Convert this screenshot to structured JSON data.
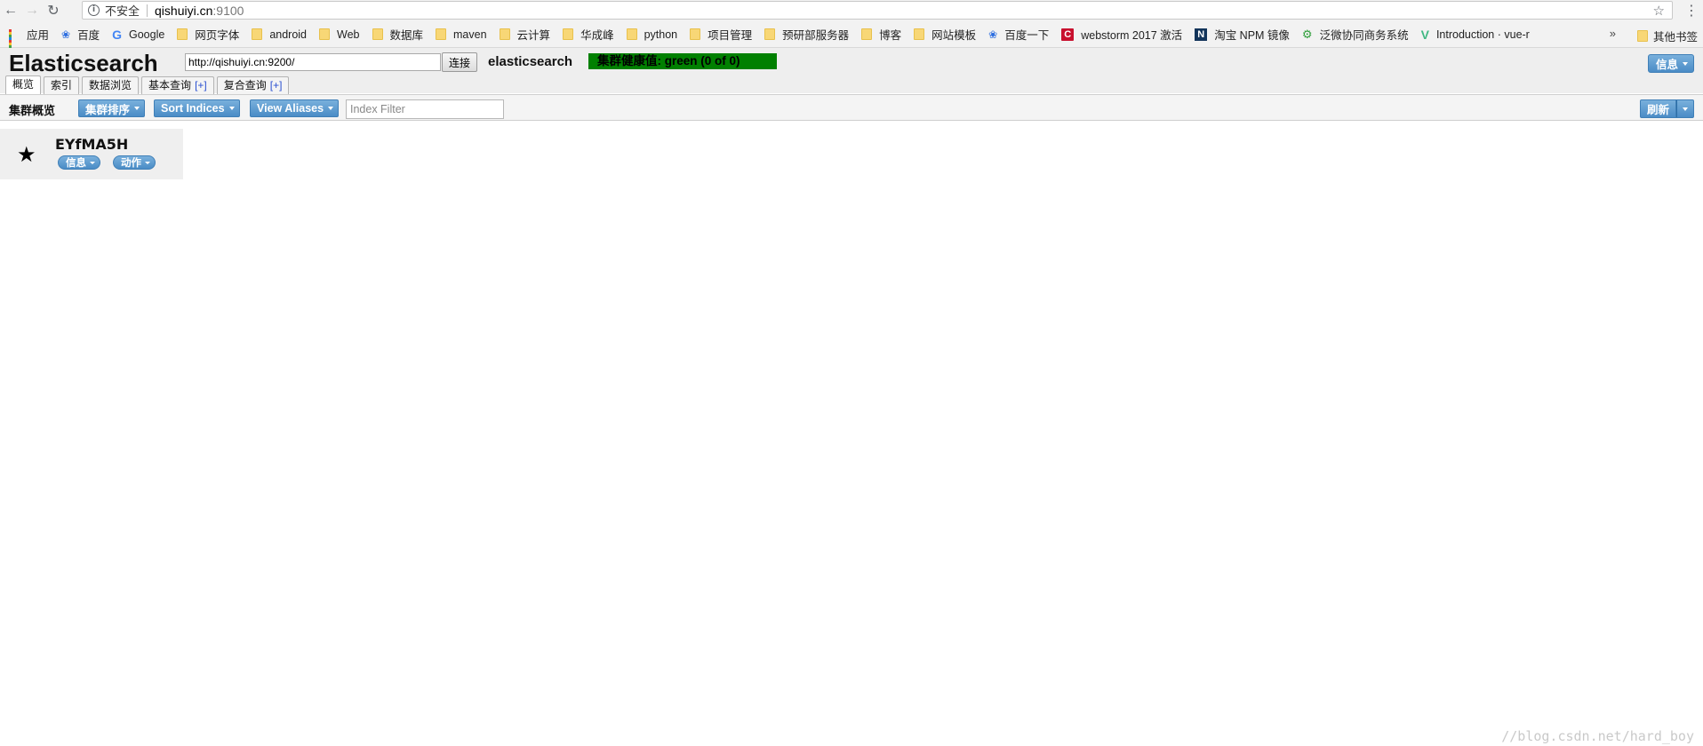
{
  "browser": {
    "security_label": "不安全",
    "url_host": "qishuiyi.cn",
    "url_port": ":9100",
    "bookmarks": [
      {
        "label": "应用",
        "icon": "apps-icon"
      },
      {
        "label": "百度",
        "icon": "paw-icon"
      },
      {
        "label": "Google",
        "icon": "google-icon"
      },
      {
        "label": "网页字体",
        "icon": "folder-icon"
      },
      {
        "label": "android",
        "icon": "folder-icon"
      },
      {
        "label": "Web",
        "icon": "folder-icon"
      },
      {
        "label": "数据库",
        "icon": "folder-icon"
      },
      {
        "label": "maven",
        "icon": "folder-icon"
      },
      {
        "label": "云计算",
        "icon": "folder-icon"
      },
      {
        "label": "华成峰",
        "icon": "folder-icon"
      },
      {
        "label": "python",
        "icon": "folder-icon"
      },
      {
        "label": "项目管理",
        "icon": "folder-icon"
      },
      {
        "label": "预研部服务器",
        "icon": "folder-icon"
      },
      {
        "label": "博客",
        "icon": "folder-icon"
      },
      {
        "label": "网站模板",
        "icon": "folder-icon"
      },
      {
        "label": "百度一下",
        "icon": "paw-icon"
      },
      {
        "label": "webstorm 2017 激活",
        "icon": "c-icon"
      },
      {
        "label": "淘宝 NPM 镜像",
        "icon": "n-icon"
      },
      {
        "label": "泛微协同商务系统",
        "icon": "gear-icon"
      },
      {
        "label": "Introduction · vue-r",
        "icon": "vue-icon"
      }
    ],
    "more_label": "»",
    "other_bookmarks": "其他书签"
  },
  "app": {
    "title": "Elasticsearch",
    "connect_url": "http://qishuiyi.cn:9200/",
    "connect_label": "连接",
    "cluster_name": "elasticsearch",
    "health": "集群健康值: green (0 of 0)",
    "info_label": "信息",
    "tabs": [
      {
        "label": "概览",
        "plus": ""
      },
      {
        "label": "索引",
        "plus": ""
      },
      {
        "label": "数据浏览",
        "plus": ""
      },
      {
        "label": "基本查询",
        "plus": "[+]"
      },
      {
        "label": "复合查询",
        "plus": "[+]"
      }
    ]
  },
  "toolbar": {
    "title": "集群概览",
    "sort_cluster": "集群排序",
    "sort_indices": "Sort Indices",
    "view_aliases": "View Aliases",
    "filter_placeholder": "Index Filter",
    "refresh": "刷新"
  },
  "node": {
    "name": "EYfMA5H",
    "info": "信息",
    "action": "动作"
  },
  "watermark": "//blog.csdn.net/hard_boy",
  "colors": {
    "health_green": "#008000",
    "button_blue": "#4a8cc6"
  }
}
